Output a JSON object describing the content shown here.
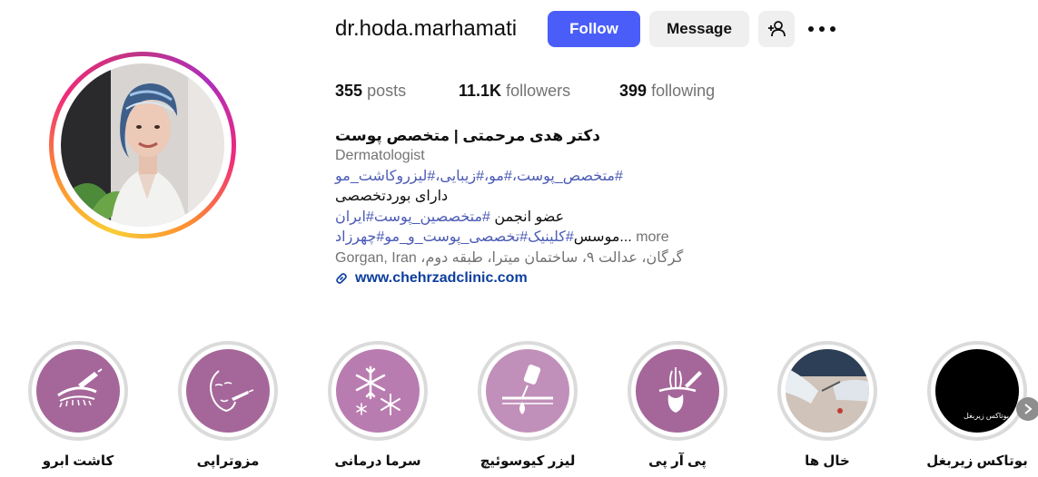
{
  "profile": {
    "username": "dr.hoda.marhamati",
    "follow_label": "Follow",
    "message_label": "Message"
  },
  "stats": {
    "posts_count": "355",
    "posts_label": "posts",
    "followers_count": "11.1K",
    "followers_label": "followers",
    "following_count": "399",
    "following_label": "following"
  },
  "bio": {
    "name": "دکتر هدی مرحمتی | متخصص پوست",
    "category": "Dermatologist",
    "line1_tags": "#متخصص_پوست،#مو،#زیبایی،#لیزروکاشت_مو",
    "line2": "دارای بوردتخصصی",
    "line3_text": "عضو انجمن ",
    "line3_tags": "#متخصصین_پوست#ایران",
    "line4_text": "موسس",
    "line4_tags": "#کلینیک#تخصصی_پوست_و_مو#چهرزاد",
    "line4_ellipsis": "...",
    "more_label": "more",
    "address": "Gorgan, Iran ،گرگان، عدالت ۹، ساختمان میترا، طبقه دوم",
    "website": "www.chehrzadclinic.com"
  },
  "highlights": [
    {
      "label": "کاشت ابرو",
      "icon": "eyebrow-tattoo-icon",
      "color": "#a5679a"
    },
    {
      "label": "مزوتراپی",
      "icon": "face-injection-icon",
      "color": "#a5679a"
    },
    {
      "label": "سرما درمانی",
      "icon": "snowflake-icon",
      "color": "#b97cb0"
    },
    {
      "label": "لیزر کیوسوئیچ",
      "icon": "laser-skin-icon",
      "color": "#c190ba"
    },
    {
      "label": "پی آر پی",
      "icon": "hair-follicle-injection-icon",
      "color": "#a5679a"
    },
    {
      "label": "خال ها",
      "icon": "mole-removal-photo",
      "color": "#d9cfc8"
    },
    {
      "label": "بوتاکس زیربغل",
      "icon": "underarm-botox-photo",
      "color": "#000000",
      "overlay_text": "بوتاکس زیربغل"
    }
  ],
  "colors": {
    "follow_button": "#4a5df9",
    "hashtag": "#4b5bb5",
    "website_link": "#0c3e9e",
    "secondary_text": "#737373"
  }
}
